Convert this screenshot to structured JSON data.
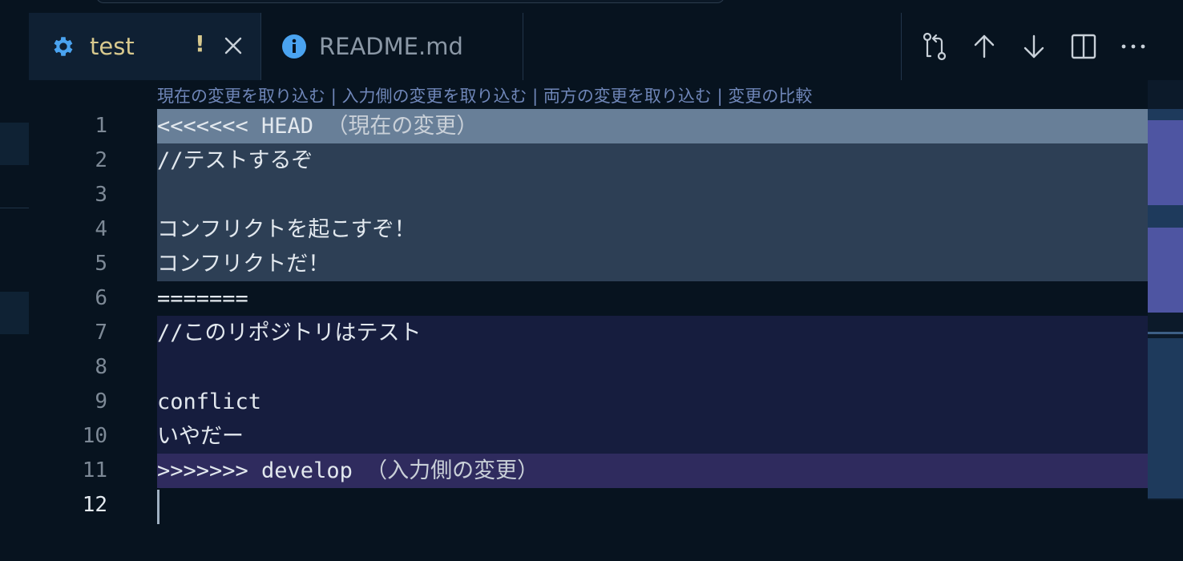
{
  "tabs": [
    {
      "label": "test",
      "icon": "gear-icon",
      "modified_marker": "!",
      "active": true
    },
    {
      "label": "README.md",
      "icon": "info-icon",
      "active": false
    }
  ],
  "codelens": {
    "accept_current": "現在の変更を取り込む",
    "accept_incoming": "入力側の変更を取り込む",
    "accept_both": "両方の変更を取り込む",
    "compare": "変更の比較",
    "separator": "|"
  },
  "lines": [
    {
      "num": "1",
      "text": "<<<<<<< HEAD",
      "label": "（現在の変更）",
      "region": "current-header"
    },
    {
      "num": "2",
      "text": "//テストするぞ",
      "region": "current"
    },
    {
      "num": "3",
      "text": "",
      "region": "current"
    },
    {
      "num": "4",
      "text": "コンフリクトを起こすぞ！",
      "region": "current"
    },
    {
      "num": "5",
      "text": "コンフリクトだ！",
      "region": "current"
    },
    {
      "num": "6",
      "text": "=======",
      "region": "separator"
    },
    {
      "num": "7",
      "text": "//このリポジトリはテスト",
      "region": "incoming"
    },
    {
      "num": "8",
      "text": "",
      "region": "incoming"
    },
    {
      "num": "9",
      "text": "conflict",
      "region": "incoming"
    },
    {
      "num": "10",
      "text": "いやだー",
      "region": "incoming"
    },
    {
      "num": "11",
      "text": ">>>>>>> develop",
      "label": "（入力側の変更）",
      "region": "incoming-header"
    },
    {
      "num": "12",
      "text": "",
      "region": "cursor-line"
    }
  ],
  "colors": {
    "current_header": "#687f98",
    "current": "#2d3f55",
    "incoming": "#161d3e",
    "incoming_header": "#2f2b5e",
    "modified": "#d8c98e",
    "codelens": "#6f86b8"
  },
  "toolbar_icons": [
    "compare-changes-icon",
    "arrow-up-icon",
    "arrow-down-icon",
    "split-editor-icon",
    "more-actions-icon"
  ]
}
